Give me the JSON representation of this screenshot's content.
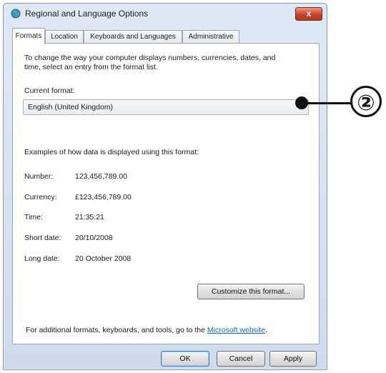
{
  "window": {
    "title": "Regional and Language Options",
    "close_label": "x"
  },
  "tabs": [
    {
      "label": "Formats",
      "active": true
    },
    {
      "label": "Location",
      "active": false
    },
    {
      "label": "Keyboards and Languages",
      "active": false
    },
    {
      "label": "Administrative",
      "active": false
    }
  ],
  "formats": {
    "intro_line1": "To change the way your computer displays numbers, currencies, dates, and",
    "intro_line2": "time, select an entry from the format list.",
    "current_format_label": "Current format:",
    "current_format_value": "English (United Kingdom)",
    "examples_heading": "Examples of how data is displayed using this format:",
    "examples": [
      {
        "label": "Number:",
        "value": "123,456,789.00"
      },
      {
        "label": "Currency:",
        "value": "£123,456,789.00"
      },
      {
        "label": "Time:",
        "value": "21:35:21"
      },
      {
        "label": "Short date:",
        "value": "20/10/2008"
      },
      {
        "label": "Long date:",
        "value": "20 October 2008"
      }
    ],
    "customize_button": "Customize this format...",
    "footer_text": "For additional formats, keyboards, and tools, go to the ",
    "footer_link": "Microsoft website",
    "footer_end": "."
  },
  "buttons": {
    "ok": "OK",
    "cancel": "Cancel",
    "apply": "Apply"
  },
  "annotation": {
    "number": "②"
  },
  "colors": {
    "link": "#1565c0",
    "close_button": "#c9432a",
    "window_frame": "#cfdcee"
  }
}
